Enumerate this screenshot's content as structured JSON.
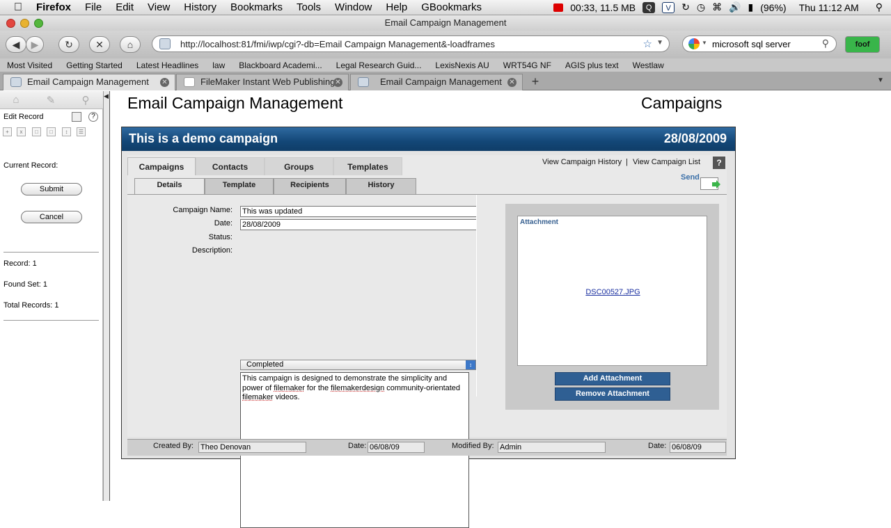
{
  "menubar": {
    "apple": "",
    "app": "Firefox",
    "items": [
      "File",
      "Edit",
      "View",
      "History",
      "Bookmarks",
      "Tools",
      "Window",
      "Help",
      "GBookmarks"
    ],
    "status": "00:33, 11.5 MB",
    "battery": "(96%)",
    "clock": "Thu 11:12 AM"
  },
  "window": {
    "title": "Email Campaign Management"
  },
  "nav": {
    "url": "http://localhost:81/fmi/iwp/cgi?-db=Email Campaign Management&-loadframes",
    "search": "microsoft sql server",
    "addon": "foof"
  },
  "bookmarks": [
    "Most Visited",
    "Getting Started",
    "Latest Headlines",
    "law",
    "Blackboard Academi...",
    "Legal Research Guid...",
    "LexisNexis AU",
    "WRT54G NF",
    "AGIS plus text",
    "Westlaw"
  ],
  "tabs": [
    {
      "label": "Email Campaign Management"
    },
    {
      "label": "FileMaker Instant Web Publishing"
    },
    {
      "label": "Email Campaign Management"
    }
  ],
  "sidebar": {
    "mode": "Edit Record",
    "current_record": "Current Record:",
    "submit": "Submit",
    "cancel": "Cancel",
    "record": "Record: 1",
    "found_set": "Found Set: 1",
    "total_records": "Total Records: 1"
  },
  "page": {
    "app_title": "Email Campaign Management",
    "section": "Campaigns",
    "campaign_title": "This is a demo campaign",
    "campaign_date": "28/08/2009"
  },
  "main_tabs": [
    "Campaigns",
    "Contacts",
    "Groups",
    "Templates"
  ],
  "sub_tabs": [
    "Details",
    "Template",
    "Recipients",
    "History"
  ],
  "links": {
    "history": "View Campaign History",
    "separator": "|",
    "list": "View Campaign List",
    "help": "?",
    "send": "Send"
  },
  "form": {
    "name_label": "Campaign Name:",
    "name_value": "This was updated",
    "date_label": "Date:",
    "date_value": "28/08/2009",
    "status_label": "Status:",
    "status_value": "Completed",
    "desc_label": "Description:",
    "desc_parts": [
      "This campaign is designed to demonstrate the simplicity and power of ",
      "filemaker",
      " for the ",
      "filemakerdesign",
      " community-orientated ",
      "filemaker",
      " videos."
    ]
  },
  "attachment": {
    "label": "Attachment",
    "file": "DSC00527.JPG",
    "add": "Add Attachment",
    "remove": "Remove Attachment"
  },
  "footer": {
    "created_label": "Created By:",
    "created_value": "Theo Denovan",
    "date1_label": "Date:",
    "date1_value": "06/08/09",
    "modified_label": "Modified By:",
    "modified_value": "Admin",
    "date2_label": "Date:",
    "date2_value": "06/08/09"
  }
}
